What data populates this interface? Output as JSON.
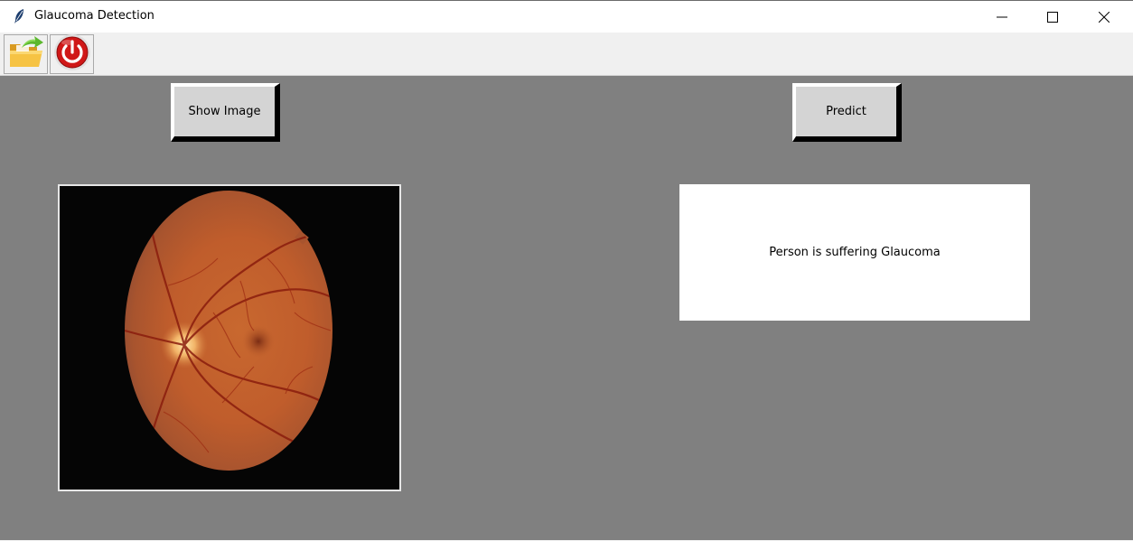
{
  "window": {
    "title": "Glaucoma Detection",
    "title_icon": "feather-icon",
    "controls": [
      "minimize-icon",
      "maximize-icon",
      "close-icon"
    ]
  },
  "toolbar": {
    "buttons": [
      {
        "icon": "open-folder-icon",
        "colors": {
          "folder": "#f2b233",
          "arrow": "#5cb82e"
        }
      },
      {
        "icon": "power-icon",
        "colors": {
          "ring": "#d01818"
        }
      }
    ]
  },
  "main": {
    "background": "#808080",
    "show_image_button": "Show Image",
    "predict_button": "Predict",
    "image": {
      "subject": "retinal fundus photograph"
    },
    "result_text": "Person is suffering Glaucoma"
  }
}
